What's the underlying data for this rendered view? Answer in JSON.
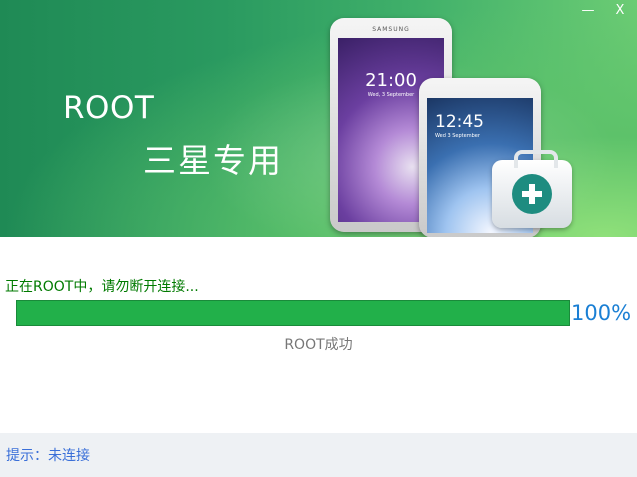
{
  "window": {
    "minimize_label": "—",
    "close_label": "X"
  },
  "banner": {
    "title": "ROOT",
    "subtitle": "三星专用",
    "phone1": {
      "brand": "SAMSUNG",
      "clock": "21:00",
      "date": "Wed, 3 September"
    },
    "phone2": {
      "clock": "12:45",
      "date": "Wed 3 September"
    },
    "icon_name": "first-aid-kit-icon"
  },
  "progress": {
    "status_text": "正在ROOT中，请勿断开连接...",
    "percent_value": 100,
    "percent_label": "100%",
    "result_text": "ROOT成功",
    "fill_color": "#22b04a",
    "percent_color": "#1a7fd4"
  },
  "footer": {
    "hint_text": "提示：未连接"
  }
}
